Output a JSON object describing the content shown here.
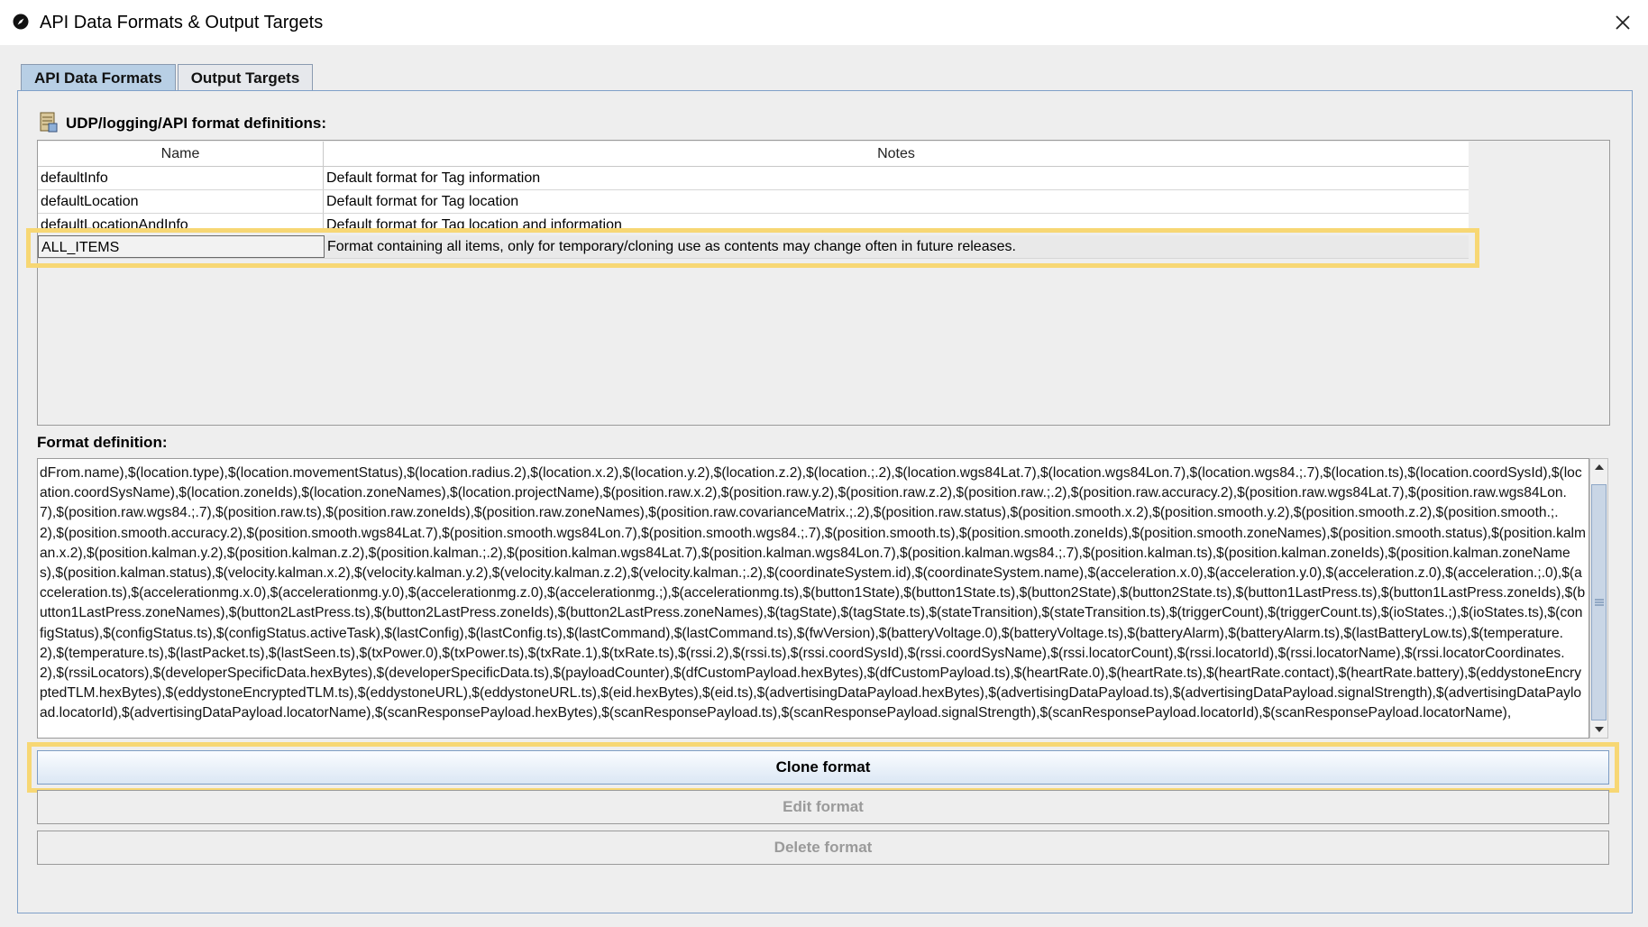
{
  "window": {
    "title": "API Data Formats & Output Targets",
    "close_symbol": "✕",
    "app_icon": "compass-icon",
    "accent_highlight": "#f7d774"
  },
  "tabs": [
    {
      "label": "API Data Formats",
      "active": true
    },
    {
      "label": "Output Targets",
      "active": false
    }
  ],
  "section": {
    "label": "UDP/logging/API format definitions:",
    "icon": "database-icon"
  },
  "table": {
    "columns": [
      "Name",
      "Notes"
    ],
    "rows": [
      {
        "name": "defaultInfo",
        "notes": "Default format for Tag information"
      },
      {
        "name": "defaultLocation",
        "notes": "Default format for Tag location"
      },
      {
        "name": "defaultLocationAndInfo",
        "notes": "Default format for Tag location and information"
      },
      {
        "name": "ALL_ITEMS",
        "notes": "Format containing all items, only for temporary/cloning use as contents may change often in future releases.",
        "selected": true
      }
    ]
  },
  "format_definition": {
    "label": "Format definition:",
    "value": "dFrom.name),$(location.type),$(location.movementStatus),$(location.radius.2),$(location.x.2),$(location.y.2),$(location.z.2),$(location.;.2),$(location.wgs84Lat.7),$(location.wgs84Lon.7),$(location.wgs84.;.7),$(location.ts),$(location.coordSysId),$(location.coordSysName),$(location.zoneIds),$(location.zoneNames),$(location.projectName),$(position.raw.x.2),$(position.raw.y.2),$(position.raw.z.2),$(position.raw.;.2),$(position.raw.accuracy.2),$(position.raw.wgs84Lat.7),$(position.raw.wgs84Lon.7),$(position.raw.wgs84.;.7),$(position.raw.ts),$(position.raw.zoneIds),$(position.raw.zoneNames),$(position.raw.covarianceMatrix.;.2),$(position.raw.status),$(position.smooth.x.2),$(position.smooth.y.2),$(position.smooth.z.2),$(position.smooth.;.2),$(position.smooth.accuracy.2),$(position.smooth.wgs84Lat.7),$(position.smooth.wgs84Lon.7),$(position.smooth.wgs84.;.7),$(position.smooth.ts),$(position.smooth.zoneIds),$(position.smooth.zoneNames),$(position.smooth.status),$(position.kalman.x.2),$(position.kalman.y.2),$(position.kalman.z.2),$(position.kalman.;.2),$(position.kalman.wgs84Lat.7),$(position.kalman.wgs84Lon.7),$(position.kalman.wgs84.;.7),$(position.kalman.ts),$(position.kalman.zoneIds),$(position.kalman.zoneNames),$(position.kalman.status),$(velocity.kalman.x.2),$(velocity.kalman.y.2),$(velocity.kalman.z.2),$(velocity.kalman.;.2),$(coordinateSystem.id),$(coordinateSystem.name),$(acceleration.x.0),$(acceleration.y.0),$(acceleration.z.0),$(acceleration.;.0),$(acceleration.ts),$(accelerationmg.x.0),$(accelerationmg.y.0),$(accelerationmg.z.0),$(accelerationmg.;),$(accelerationmg.ts),$(button1State),$(button1State.ts),$(button2State),$(button2State.ts),$(button1LastPress.ts),$(button1LastPress.zoneIds),$(button1LastPress.zoneNames),$(button2LastPress.ts),$(button2LastPress.zoneIds),$(button2LastPress.zoneNames),$(tagState),$(tagState.ts),$(stateTransition),$(stateTransition.ts),$(triggerCount),$(triggerCount.ts),$(ioStates.;),$(ioStates.ts),$(configStatus),$(configStatus.ts),$(configStatus.activeTask),$(lastConfig),$(lastConfig.ts),$(lastCommand),$(lastCommand.ts),$(fwVersion),$(batteryVoltage.0),$(batteryVoltage.ts),$(batteryAlarm),$(batteryAlarm.ts),$(lastBatteryLow.ts),$(temperature.2),$(temperature.ts),$(lastPacket.ts),$(lastSeen.ts),$(txPower.0),$(txPower.ts),$(txRate.1),$(txRate.ts),$(rssi.2),$(rssi.ts),$(rssi.coordSysId),$(rssi.coordSysName),$(rssi.locatorCount),$(rssi.locatorId),$(rssi.locatorName),$(rssi.locatorCoordinates.2),$(rssiLocators),$(developerSpecificData.hexBytes),$(developerSpecificData.ts),$(payloadCounter),$(dfCustomPayload.hexBytes),$(dfCustomPayload.ts),$(heartRate.0),$(heartRate.ts),$(heartRate.contact),$(heartRate.battery),$(eddystoneEncryptedTLM.hexBytes),$(eddystoneEncryptedTLM.ts),$(eddystoneURL),$(eddystoneURL.ts),$(eid.hexBytes),$(eid.ts),$(advertisingDataPayload.hexBytes),$(advertisingDataPayload.ts),$(advertisingDataPayload.signalStrength),$(advertisingDataPayload.locatorId),$(advertisingDataPayload.locatorName),$(scanResponsePayload.hexBytes),$(scanResponsePayload.ts),$(scanResponsePayload.signalStrength),$(scanResponsePayload.locatorId),$(scanResponsePayload.locatorName),"
  },
  "buttons": {
    "clone": "Clone format",
    "edit": "Edit format",
    "delete": "Delete format"
  }
}
